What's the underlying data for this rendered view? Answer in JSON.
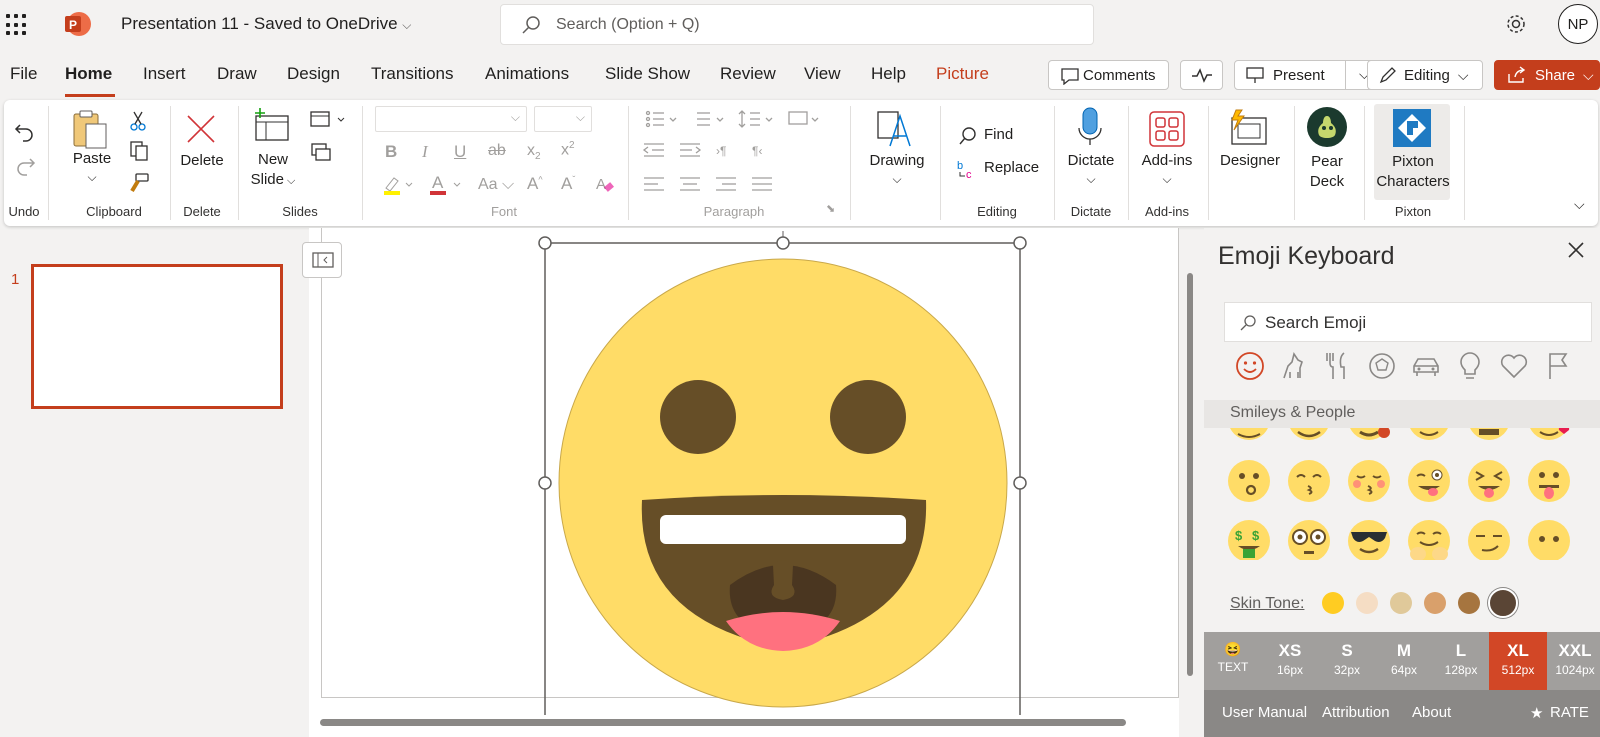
{
  "titlebar": {
    "app_icon": "powerpoint-logo",
    "title": "Presentation 11  -  Saved to OneDrive",
    "search_placeholder": "Search (Option + Q)",
    "avatar_initials": "NP"
  },
  "tabs": [
    "File",
    "Home",
    "Insert",
    "Draw",
    "Design",
    "Transitions",
    "Animations",
    "Slide Show",
    "Review",
    "View",
    "Help",
    "Picture"
  ],
  "active_tab": "Home",
  "actions": {
    "comments": "Comments",
    "present": "Present",
    "editing": "Editing",
    "share": "Share"
  },
  "ribbon": {
    "undo_group": "Undo",
    "clipboard": {
      "paste": "Paste",
      "group": "Clipboard"
    },
    "delete": {
      "label": "Delete",
      "group": "Delete"
    },
    "slides": {
      "new_slide_line1": "New",
      "new_slide_line2": "Slide",
      "group": "Slides"
    },
    "font_group": "Font",
    "paragraph_group": "Paragraph",
    "drawing": {
      "label": "Drawing"
    },
    "editing": {
      "find": "Find",
      "replace": "Replace",
      "group": "Editing"
    },
    "dictate": {
      "label": "Dictate",
      "group": "Dictate"
    },
    "addins": {
      "label": "Add-ins",
      "group": "Add-ins"
    },
    "designer": {
      "label": "Designer"
    },
    "peardeck": {
      "line1": "Pear",
      "line2": "Deck"
    },
    "pixton": {
      "line1": "Pixton",
      "line2": "Characters",
      "group": "Pixton"
    }
  },
  "slides_pane": {
    "slide_number": "1"
  },
  "emoji_panel": {
    "title": "Emoji Keyboard",
    "search_placeholder": "Search Emoji",
    "categories": [
      "smileys-icon",
      "animals-icon",
      "food-icon",
      "activity-icon",
      "travel-icon",
      "objects-icon",
      "symbols-icon",
      "flags-icon"
    ],
    "section_title": "Smileys & People",
    "skin_tone_label": "Skin Tone:",
    "skin_tones": [
      "#FFCC22",
      "#F5DDC4",
      "#E0C99A",
      "#D9A06B",
      "#A6753F",
      "#5A4535"
    ],
    "sizes": [
      {
        "label": "TEXT",
        "sub": ""
      },
      {
        "label": "XS",
        "sub": "16px"
      },
      {
        "label": "S",
        "sub": "32px"
      },
      {
        "label": "M",
        "sub": "64px"
      },
      {
        "label": "L",
        "sub": "128px"
      },
      {
        "label": "XL",
        "sub": "512px"
      },
      {
        "label": "XXL",
        "sub": "1024px"
      }
    ],
    "selected_size": "XL",
    "footer": {
      "manual": "User Manual",
      "attribution": "Attribution",
      "about": "About",
      "rate": "RATE"
    }
  },
  "colors": {
    "accent": "#C43E1C",
    "emoji_face": "#FFDC67",
    "emoji_feature": "#664E27",
    "tongue": "#FF717F"
  }
}
